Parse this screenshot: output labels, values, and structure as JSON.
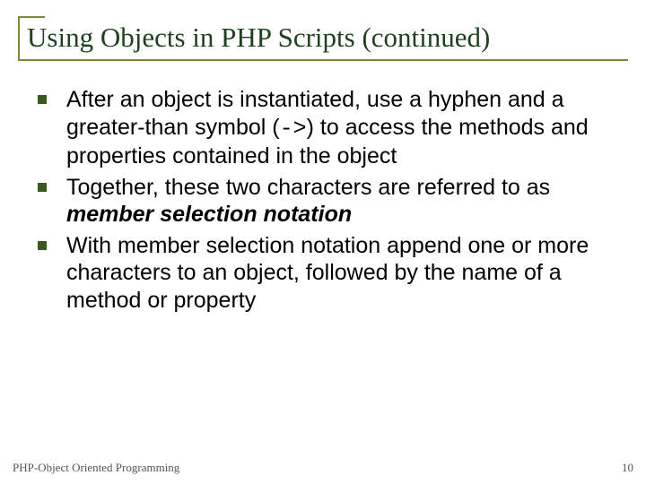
{
  "title": "Using Objects in PHP Scripts (continued)",
  "bullets": {
    "b1a": "After an object is instantiated, use a hyphen and a greater-than symbol (",
    "b1code": "->",
    "b1b": ") to access the methods and properties contained in the object",
    "b2a": "Together, these two characters are referred to as ",
    "b2em": "member selection notation",
    "b3": "With member selection notation append one or more characters to an object, followed by the name of a method or property"
  },
  "footer": {
    "left": "PHP-Object Oriented Programming",
    "page": "10"
  }
}
